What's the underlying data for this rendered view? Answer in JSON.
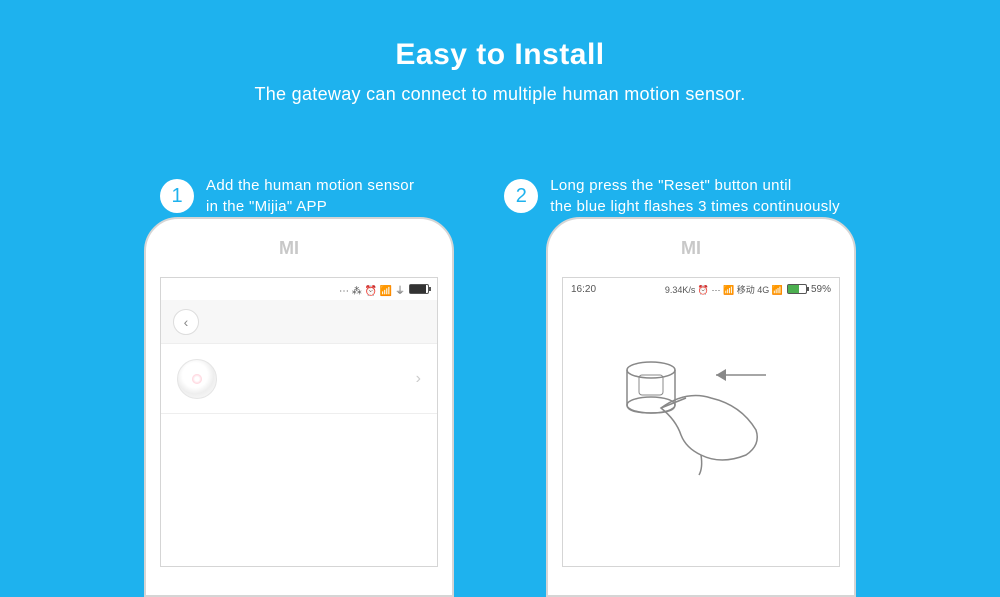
{
  "header": {
    "title": "Easy to Install",
    "subtitle": "The gateway can connect to multiple human motion sensor."
  },
  "steps": [
    {
      "num": "1",
      "text": "Add the human motion sensor\n in the \"Mijia\" APP"
    },
    {
      "num": "2",
      "text": "Long press the \"Reset\" button until\nthe blue light flashes 3 times continuously"
    }
  ],
  "phone1": {
    "status_icons": "⋯ ⁂ ⏰ 📶 ⏚",
    "back_label": "‹"
  },
  "phone2": {
    "time": "16:20",
    "status_right": "9.34K/s ⏰ ⋯ 📶 移动 4G 📶",
    "battery_pct": "59%"
  }
}
